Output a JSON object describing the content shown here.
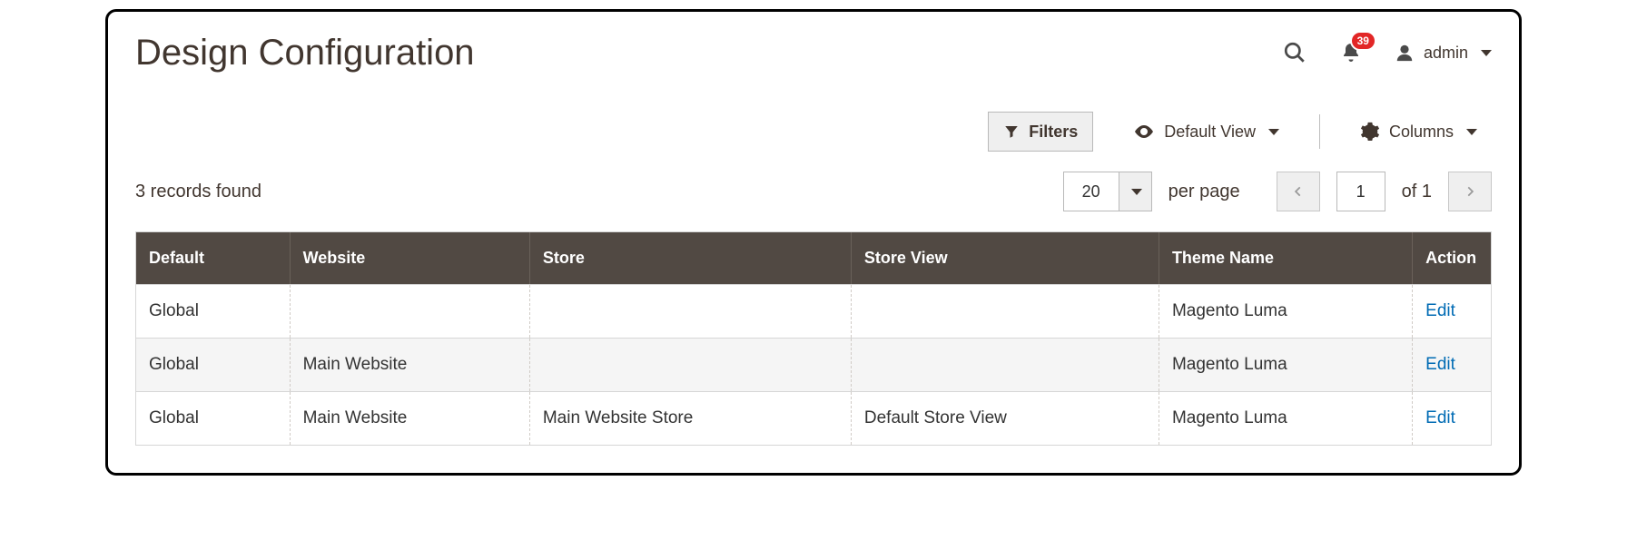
{
  "header": {
    "title": "Design Configuration",
    "notification_count": "39",
    "username": "admin"
  },
  "toolbar": {
    "filters_label": "Filters",
    "view_label": "Default View",
    "columns_label": "Columns"
  },
  "records": {
    "found_text": "3 records found",
    "page_size": "20",
    "per_page_label": "per page",
    "current_page": "1",
    "of_label": "of",
    "total_pages": "1"
  },
  "grid": {
    "headers": {
      "default": "Default",
      "website": "Website",
      "store": "Store",
      "store_view": "Store View",
      "theme_name": "Theme Name",
      "action": "Action"
    },
    "rows": [
      {
        "default": "Global",
        "website": "",
        "store": "",
        "store_view": "",
        "theme_name": "Magento Luma",
        "action": "Edit"
      },
      {
        "default": "Global",
        "website": "Main Website",
        "store": "",
        "store_view": "",
        "theme_name": "Magento Luma",
        "action": "Edit"
      },
      {
        "default": "Global",
        "website": "Main Website",
        "store": "Main Website Store",
        "store_view": "Default Store View",
        "theme_name": "Magento Luma",
        "action": "Edit"
      }
    ]
  }
}
